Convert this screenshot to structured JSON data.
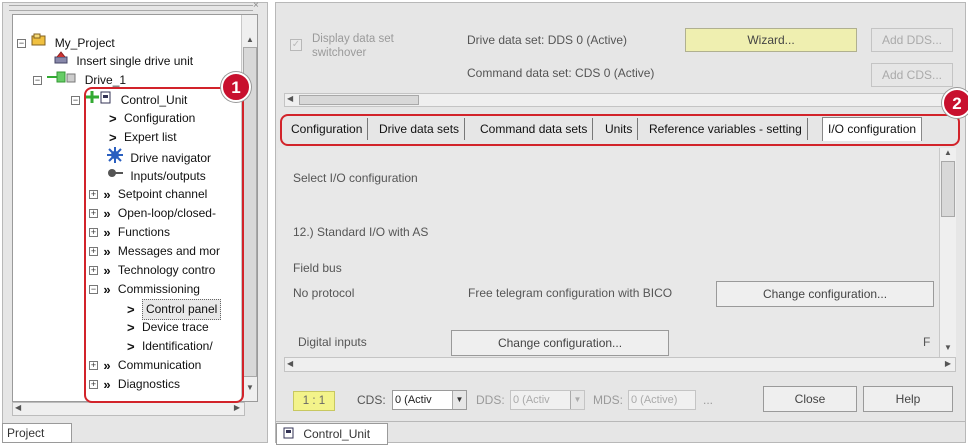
{
  "project_tree": {
    "items": [
      {
        "label": "My_Project",
        "expander": "−",
        "icon": "project-icon"
      },
      {
        "label": "Insert single drive unit",
        "icon": "insert-drive-icon"
      },
      {
        "label": "Drive_1",
        "expander": "−",
        "icon": "drive-icon"
      },
      {
        "label": "Control_Unit",
        "expander": "−",
        "icon": "control-unit-icon"
      },
      {
        "label": "Configuration",
        "icon": "chevron-right-icon"
      },
      {
        "label": "Expert list",
        "icon": "chevron-right-icon"
      },
      {
        "label": "Drive navigator",
        "icon": "navigator-icon"
      },
      {
        "label": "Inputs/outputs",
        "icon": "inputs-outputs-icon"
      },
      {
        "label": "Setpoint channel",
        "expander": "+",
        "icon": "double-chevron-icon"
      },
      {
        "label": "Open-loop/closed-",
        "expander": "+",
        "icon": "double-chevron-icon"
      },
      {
        "label": "Functions",
        "expander": "+",
        "icon": "double-chevron-icon"
      },
      {
        "label": "Messages and mor",
        "expander": "+",
        "icon": "double-chevron-icon"
      },
      {
        "label": "Technology contro",
        "expander": "+",
        "icon": "double-chevron-icon"
      },
      {
        "label": "Commissioning",
        "expander": "−",
        "icon": "double-chevron-icon"
      },
      {
        "label": "Control panel",
        "icon": "chevron-right-icon",
        "selected": true
      },
      {
        "label": "Device trace",
        "icon": "chevron-right-icon"
      },
      {
        "label": "Identification/",
        "icon": "chevron-right-icon"
      },
      {
        "label": "Communication",
        "expander": "+",
        "icon": "double-chevron-icon"
      },
      {
        "label": "Diagnostics",
        "expander": "+",
        "icon": "double-chevron-icon"
      }
    ],
    "bottom_tab": "Project"
  },
  "callouts": {
    "badge_1": "1",
    "badge_2": "2"
  },
  "header": {
    "display_data_set_label": "Display data set switchover",
    "drive_data_set": "Drive data set: DDS 0 (Active)",
    "command_data_set": "Command data set: CDS 0 (Active)",
    "wizard_button": "Wizard...",
    "add_dds_button": "Add DDS...",
    "add_cds_button": "Add CDS..."
  },
  "tabs": [
    {
      "label": "Configuration"
    },
    {
      "label": "Drive data sets"
    },
    {
      "label": "Command data sets"
    },
    {
      "label": "Units"
    },
    {
      "label": "Reference variables - setting"
    },
    {
      "label": "I/O configuration",
      "active": true
    }
  ],
  "content": {
    "select_io_label": "Select I/O configuration",
    "io_value": "12.) Standard I/O with AS",
    "field_bus_label": "Field bus",
    "protocol_value": "No protocol",
    "telegram_text": "Free telegram configuration with BICO",
    "change_config_button": "Change configuration...",
    "digital_inputs_label": "Digital inputs",
    "change_config_button_2": "Change configuration...",
    "cut_label": "F"
  },
  "footer": {
    "ratio": "1 : 1",
    "cds_label": "CDS:",
    "cds_value": "0 (Activ",
    "dds_label": "DDS:",
    "dds_value": "0 (Activ",
    "mds_label": "MDS:",
    "mds_value": "0 (Active)",
    "ellipsis": "...",
    "close_button": "Close",
    "help_button": "Help"
  },
  "status_tab": {
    "label": "Control_Unit",
    "icon": "control-unit-icon"
  },
  "colors": {
    "callout_red": "#d2232a",
    "wizard_yellow": "#efefb0",
    "ratio_yellow": "#f3f38a"
  }
}
